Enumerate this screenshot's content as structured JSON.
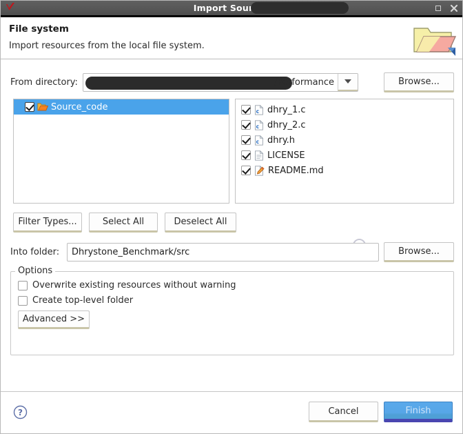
{
  "window": {
    "title": "Import Sources",
    "app_icon": "checkmark-icon",
    "title_redacted": true,
    "buttons": {
      "restore_label": "Restore",
      "close_label": "Close"
    }
  },
  "header": {
    "title": "File system",
    "description": "Import resources from the local file system.",
    "icon": "open-folder-import-icon"
  },
  "from_directory": {
    "label": "From directory:",
    "value": "/Performance",
    "redacted_prefix": true,
    "dropdown_icon": "chevron-down-icon",
    "browse_label": "Browse..."
  },
  "tree": {
    "items": [
      {
        "label": "Source_code",
        "checked": true,
        "selected": true,
        "icon": "open-folder-icon"
      }
    ]
  },
  "file_list": {
    "items": [
      {
        "name": "dhry_1.c",
        "checked": true,
        "icon": "c-file-icon"
      },
      {
        "name": "dhry_2.c",
        "checked": true,
        "icon": "c-file-icon"
      },
      {
        "name": "dhry.h",
        "checked": true,
        "icon": "c-file-icon"
      },
      {
        "name": "LICENSE",
        "checked": true,
        "icon": "plain-file-icon"
      },
      {
        "name": "README.md",
        "checked": true,
        "icon": "markdown-file-icon"
      }
    ]
  },
  "selection_buttons": {
    "filter_types": "Filter Types...",
    "select_all": "Select All",
    "deselect_all": "Deselect All"
  },
  "into_folder": {
    "label": "Into folder:",
    "value": "Dhrystone_Benchmark/src",
    "browse_label": "Browse..."
  },
  "options": {
    "legend": "Options",
    "items": [
      {
        "label": "Overwrite existing resources without warning",
        "checked": false
      },
      {
        "label": "Create top-level folder",
        "checked": false
      }
    ],
    "advanced_label": "Advanced >>"
  },
  "footer": {
    "help_icon": "help-question-icon",
    "cancel_label": "Cancel",
    "finish_label": "Finish"
  },
  "colors": {
    "titlebar": "#575757",
    "selection_blue": "#4aa3ea",
    "finish_blue": "#57a6e8",
    "finish_underline": "#4a46b0",
    "button_underline": "#c9c5a8"
  }
}
